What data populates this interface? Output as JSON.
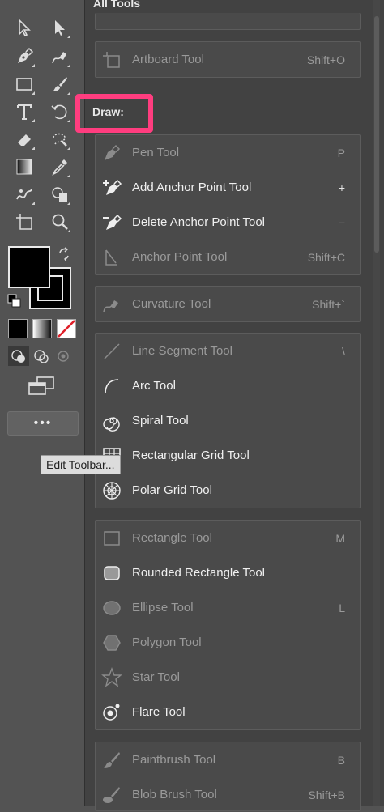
{
  "panel": {
    "title": "All Tools",
    "draw_heading": "Draw:",
    "groups": [
      {
        "rows": [
          {
            "icon": "artboard-icon",
            "label": "Artboard Tool",
            "shortcut": "Shift+O",
            "enabled": false
          }
        ]
      },
      {
        "rows": [
          {
            "icon": "pen-icon",
            "label": "Pen Tool",
            "shortcut": "P",
            "enabled": false
          },
          {
            "icon": "add-anchor-icon",
            "label": "Add Anchor Point Tool",
            "shortcut": "+",
            "enabled": true
          },
          {
            "icon": "delete-anchor-icon",
            "label": "Delete Anchor Point Tool",
            "shortcut": "−",
            "enabled": true
          },
          {
            "icon": "anchor-point-icon",
            "label": "Anchor Point Tool",
            "shortcut": "Shift+C",
            "enabled": false
          }
        ]
      },
      {
        "rows": [
          {
            "icon": "curvature-icon",
            "label": "Curvature Tool",
            "shortcut": "Shift+`",
            "enabled": false
          }
        ]
      },
      {
        "rows": [
          {
            "icon": "line-segment-icon",
            "label": "Line Segment Tool",
            "shortcut": "\\",
            "enabled": false
          },
          {
            "icon": "arc-icon",
            "label": "Arc Tool",
            "shortcut": "",
            "enabled": true
          },
          {
            "icon": "spiral-icon",
            "label": "Spiral Tool",
            "shortcut": "",
            "enabled": true
          },
          {
            "icon": "rectangular-grid-icon",
            "label": "Rectangular Grid Tool",
            "shortcut": "",
            "enabled": true
          },
          {
            "icon": "polar-grid-icon",
            "label": "Polar Grid Tool",
            "shortcut": "",
            "enabled": true
          }
        ]
      },
      {
        "rows": [
          {
            "icon": "rectangle-icon",
            "label": "Rectangle Tool",
            "shortcut": "M",
            "enabled": false
          },
          {
            "icon": "rounded-rectangle-icon",
            "label": "Rounded Rectangle Tool",
            "shortcut": "",
            "enabled": true
          },
          {
            "icon": "ellipse-icon",
            "label": "Ellipse Tool",
            "shortcut": "L",
            "enabled": false
          },
          {
            "icon": "polygon-icon",
            "label": "Polygon Tool",
            "shortcut": "",
            "enabled": false
          },
          {
            "icon": "star-icon",
            "label": "Star Tool",
            "shortcut": "",
            "enabled": false
          },
          {
            "icon": "flare-icon",
            "label": "Flare Tool",
            "shortcut": "",
            "enabled": true
          }
        ]
      },
      {
        "rows": [
          {
            "icon": "paintbrush-icon",
            "label": "Paintbrush Tool",
            "shortcut": "B",
            "enabled": false
          },
          {
            "icon": "blob-brush-icon",
            "label": "Blob Brush Tool",
            "shortcut": "Shift+B",
            "enabled": false
          }
        ]
      }
    ]
  },
  "toolbar": {
    "edit_button_label": "•••",
    "tooltip": "Edit Toolbar...",
    "tools": [
      "selection-icon",
      "direct-selection-icon",
      "pen-icon",
      "curvature-icon",
      "rectangle-icon",
      "paintbrush-icon",
      "type-icon",
      "rotate-icon",
      "eraser-icon",
      "warp-icon",
      "gradient-icon",
      "eyedropper-icon",
      "puppet-warp-icon",
      "shape-builder-icon",
      "artboard-icon",
      "zoom-icon"
    ]
  },
  "colors": {
    "highlight": "#ff3d7f",
    "fill": "#000000",
    "stroke": "#000000"
  }
}
